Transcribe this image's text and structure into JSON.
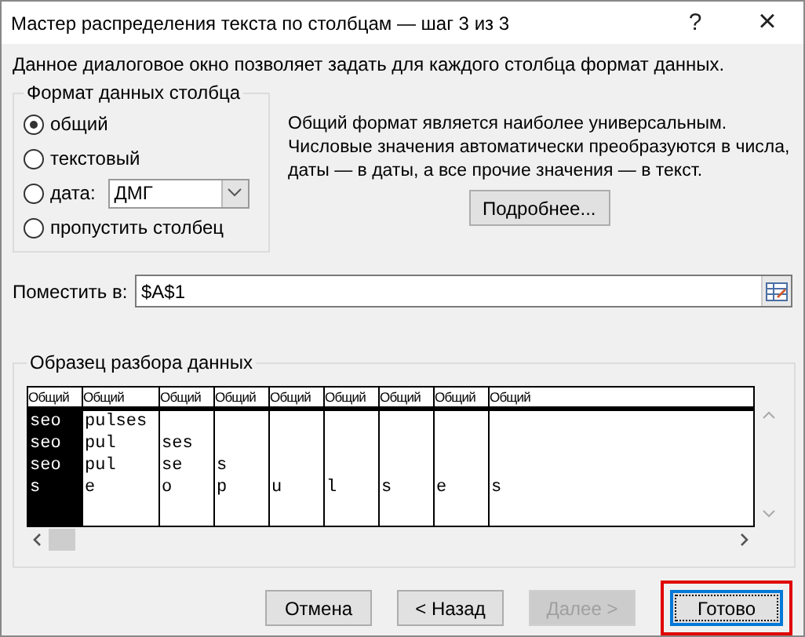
{
  "window": {
    "title": "Мастер распределения текста по столбцам — шаг 3 из 3",
    "help": "?",
    "close": "×"
  },
  "description": "Данное диалоговое окно позволяет задать для каждого столбца формат данных.",
  "format_group": {
    "title": "Формат данных столбца",
    "options": [
      {
        "label": "общий",
        "selected": true,
        "kind": "plain"
      },
      {
        "label": "текстовый",
        "selected": false,
        "kind": "plain"
      },
      {
        "label": "дата:",
        "selected": false,
        "kind": "date",
        "value": "ДМГ"
      },
      {
        "label": "пропустить столбец",
        "selected": false,
        "kind": "plain"
      }
    ]
  },
  "info": "Общий формат является наиболее универсальным. Числовые значения автоматически преобразуются в числа, даты — в даты, а все прочие значения — в текст.",
  "details_button": "Подробнее...",
  "destination": {
    "label": "Поместить в:",
    "value": "$A$1"
  },
  "preview": {
    "title": "Образец разбора данных",
    "columns": [
      {
        "header": "Общий",
        "selected": true
      },
      {
        "header": "Общий",
        "selected": false
      },
      {
        "header": "Общий",
        "selected": false
      },
      {
        "header": "Общий",
        "selected": false
      },
      {
        "header": "Общий",
        "selected": false
      },
      {
        "header": "Общий",
        "selected": false
      },
      {
        "header": "Общий",
        "selected": false
      },
      {
        "header": "Общий",
        "selected": false
      },
      {
        "header": "Общий",
        "selected": false
      }
    ],
    "rows": [
      [
        "seo",
        "pulses"
      ],
      [
        "seo",
        "pul",
        "ses"
      ],
      [
        "seo",
        "pul",
        "se",
        "s"
      ],
      [
        "s",
        "e",
        "o",
        "p",
        "u",
        "l",
        "s",
        "e",
        "s"
      ]
    ]
  },
  "buttons": [
    {
      "label": "Отмена",
      "disabled": false,
      "highlighted": false
    },
    {
      "label": "< Назад",
      "disabled": false,
      "highlighted": false
    },
    {
      "label": "Далее >",
      "disabled": true,
      "highlighted": false
    },
    {
      "label": "Готово",
      "disabled": false,
      "highlighted": true
    }
  ]
}
